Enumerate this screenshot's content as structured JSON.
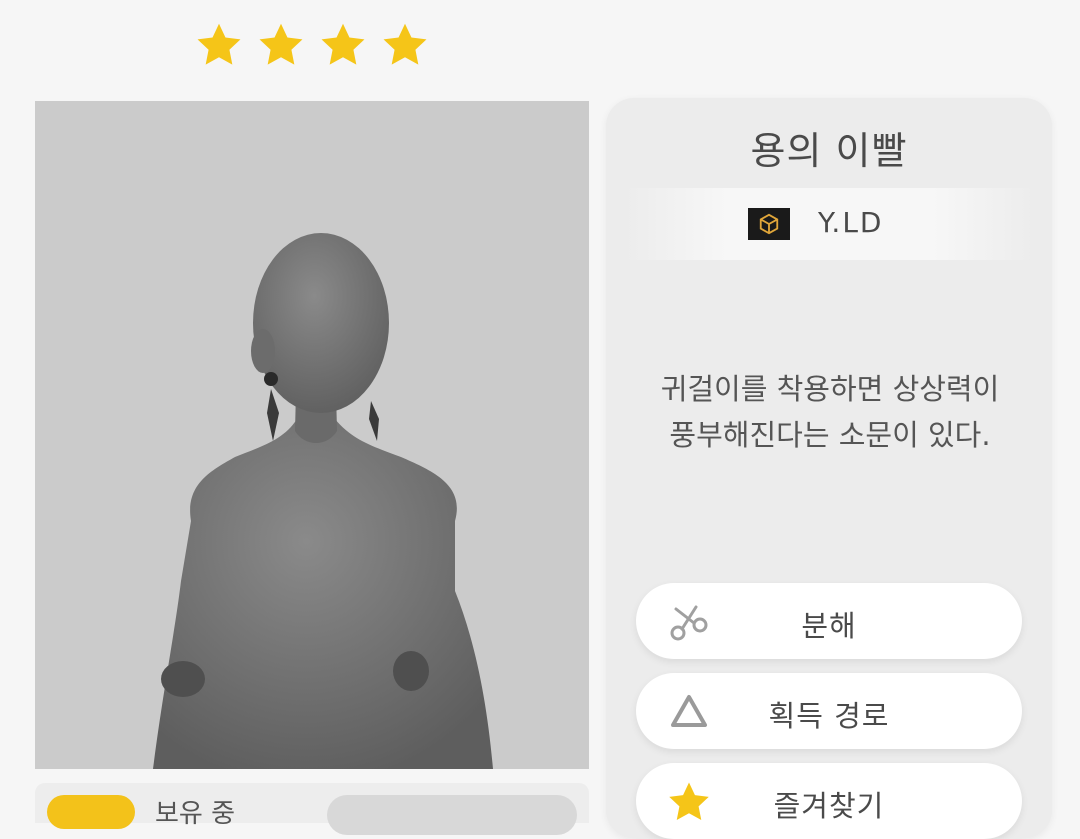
{
  "rarity": {
    "stars": 4,
    "star_color": "#f5c518"
  },
  "item": {
    "name": "용의 이빨",
    "brand": {
      "icon": "brand-cube-icon",
      "name": "Y.LD"
    },
    "description_lines": [
      "귀걸이를 착용하면 상상력이",
      "풍부해진다는 소문이 있다."
    ]
  },
  "actions": {
    "dismantle": {
      "label": "분해",
      "icon": "scissors-icon"
    },
    "source": {
      "label": "획득 경로",
      "icon": "triangle-icon"
    },
    "favorite": {
      "label": "즐겨찾기",
      "icon": "star-icon"
    }
  },
  "status": {
    "owned_label": "보유 중"
  },
  "colors": {
    "accent": "#f5c518",
    "panel": "#ececec",
    "preview_bg": "#cbcbcb"
  }
}
